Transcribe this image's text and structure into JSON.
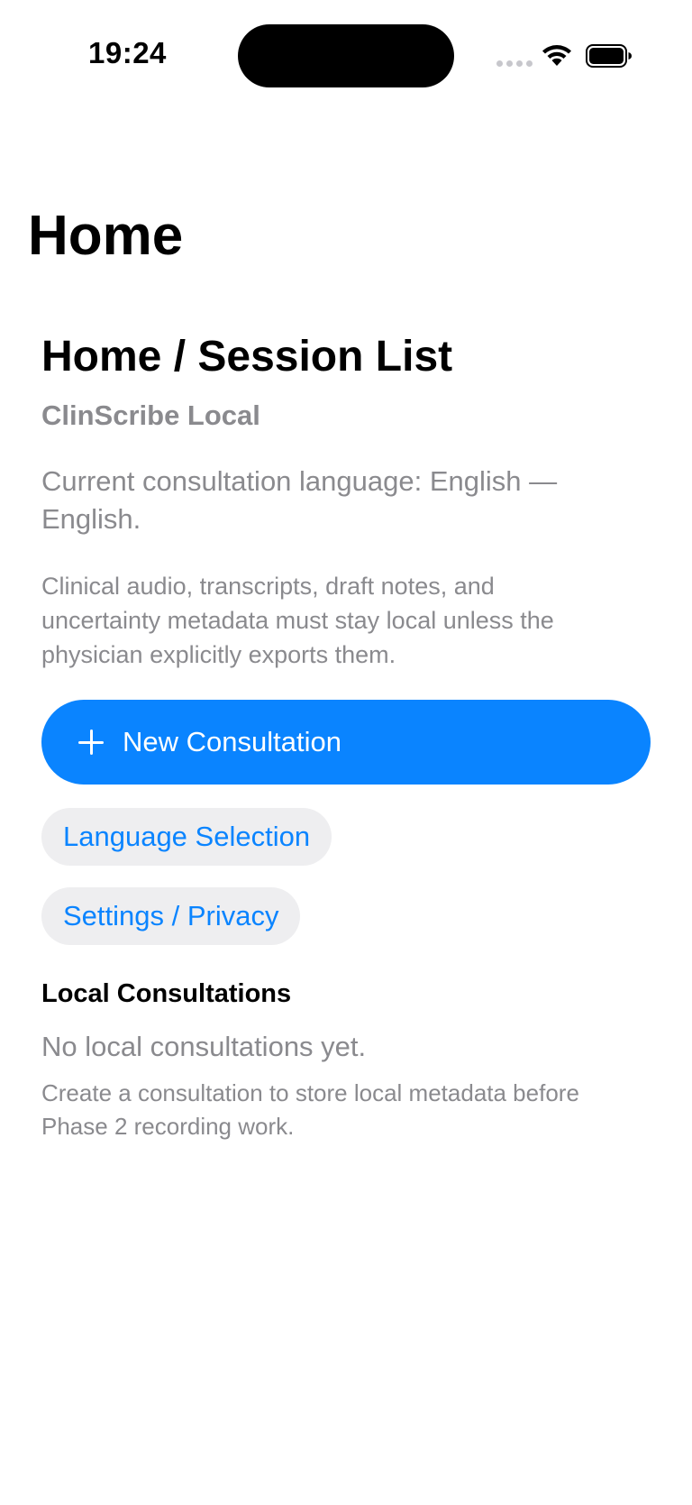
{
  "status_bar": {
    "time": "19:24"
  },
  "nav": {
    "large_title": "Home"
  },
  "main": {
    "section_title": "Home / Session List",
    "app_name": "ClinScribe Local",
    "language_line": "Current consultation language: English — English.",
    "privacy_note": "Clinical audio, transcripts, draft notes, and uncertainty metadata must stay local unless the physician explicitly exports them.",
    "new_consultation_label": "New Consultation",
    "language_selection_label": "Language Selection",
    "settings_privacy_label": "Settings / Privacy"
  },
  "consultations": {
    "header": "Local Consultations",
    "empty_title": "No local consultations yet.",
    "empty_description": "Create a consultation to store local metadata before Phase 2 recording work."
  },
  "colors": {
    "accent": "#0a84ff",
    "secondary_text": "#8a8a8e",
    "secondary_button_bg": "#eeeef0"
  },
  "icons": [
    "wifi-icon",
    "battery-icon",
    "cellular-signal-icon",
    "plus-icon"
  ]
}
